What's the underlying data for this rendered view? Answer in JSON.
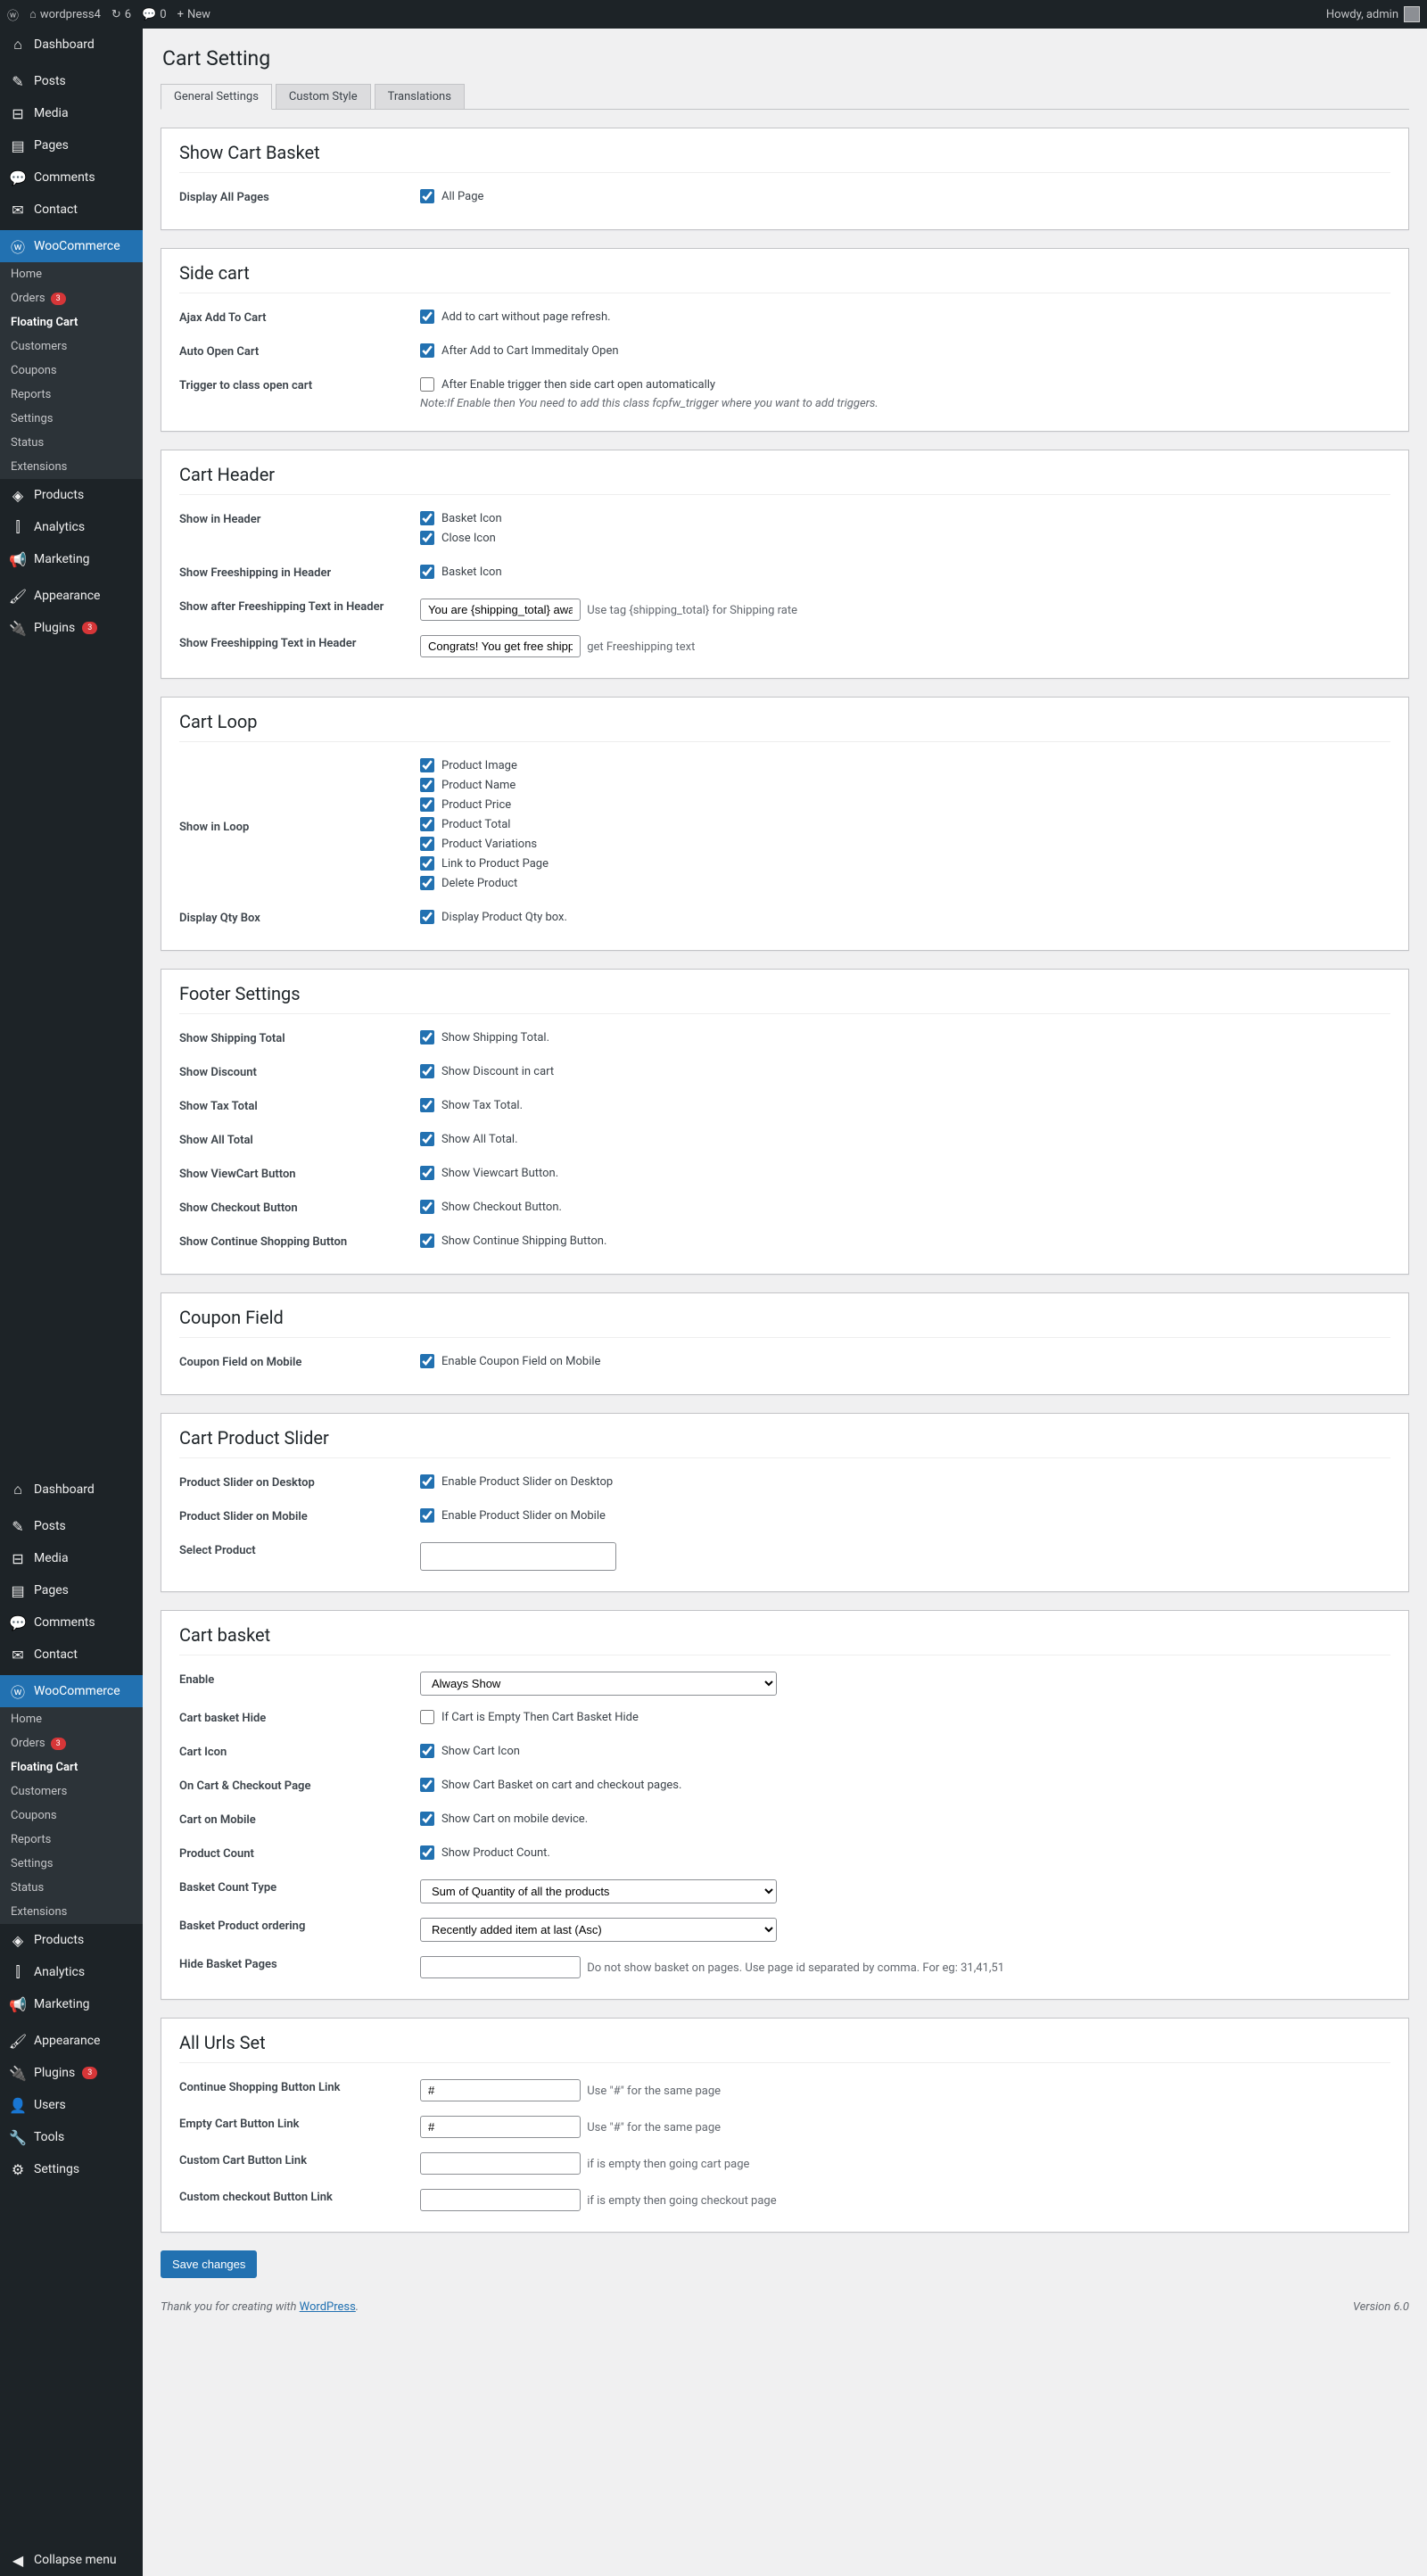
{
  "toolbar": {
    "site_name": "wordpress4",
    "updates": "6",
    "comments": "0",
    "new": "New",
    "howdy": "Howdy, admin"
  },
  "sidebar": {
    "dashboard": "Dashboard",
    "posts": "Posts",
    "media": "Media",
    "pages": "Pages",
    "comments": "Comments",
    "contact": "Contact",
    "woocommerce": "WooCommerce",
    "woo_sub": {
      "home": "Home",
      "orders": "Orders",
      "orders_count": "3",
      "floating_cart": "Floating Cart",
      "customers": "Customers",
      "coupons": "Coupons",
      "reports": "Reports",
      "settings": "Settings",
      "status": "Status",
      "extensions": "Extensions"
    },
    "products": "Products",
    "analytics": "Analytics",
    "marketing": "Marketing",
    "appearance": "Appearance",
    "plugins": "Plugins",
    "plugins_count": "3",
    "users": "Users",
    "tools": "Tools",
    "settings": "Settings",
    "collapse": "Collapse menu"
  },
  "page": {
    "title": "Cart Setting",
    "tabs": {
      "general": "General Settings",
      "custom": "Custom Style",
      "translations": "Translations"
    }
  },
  "sections": {
    "show_cart_basket": {
      "title": "Show Cart Basket",
      "display_all_pages": "Display All Pages",
      "all_page": "All Page"
    },
    "side_cart": {
      "title": "Side cart",
      "ajax_label": "Ajax Add To Cart",
      "ajax_text": "Add to cart without page refresh.",
      "auto_label": "Auto Open Cart",
      "auto_text": "After Add to Cart Immeditaly Open",
      "trigger_label": "Trigger to class open cart",
      "trigger_text": "After Enable trigger then side cart open automatically",
      "trigger_note_pre": "Note:If Enable then You need to add this class",
      "trigger_class": "fcpfw_trigger",
      "trigger_note_post": "where you want to add triggers."
    },
    "cart_header": {
      "title": "Cart Header",
      "show_header": "Show in Header",
      "basket_icon": "Basket Icon",
      "close_icon": "Close Icon",
      "show_freeship": "Show Freeshipping in Header",
      "after_freeship_label": "Show after Freeshipping Text in Header",
      "after_freeship_value": "You are {shipping_total} away",
      "after_freeship_note_pre": "Use tag",
      "after_freeship_tag": "{shipping_total}",
      "after_freeship_note_post": "for Shipping rate",
      "freeship_text_label": "Show Freeshipping Text in Header",
      "freeship_text_value": "Congrats! You get free shipping",
      "freeship_text_note": "get Freeshipping text"
    },
    "cart_loop": {
      "title": "Cart Loop",
      "show_loop": "Show in Loop",
      "items": [
        "Product Image",
        "Product Name",
        "Product Price",
        "Product Total",
        "Product Variations",
        "Link to Product Page",
        "Delete Product"
      ],
      "qty_label": "Display Qty Box",
      "qty_text": "Display Product Qty box."
    },
    "footer": {
      "title": "Footer Settings",
      "rows": [
        {
          "label": "Show Shipping Total",
          "text": "Show Shipping Total."
        },
        {
          "label": "Show Discount",
          "text": "Show Discount in cart"
        },
        {
          "label": "Show Tax Total",
          "text": "Show Tax Total."
        },
        {
          "label": "Show All Total",
          "text": "Show All Total."
        },
        {
          "label": "Show ViewCart Button",
          "text": "Show Viewcart Button."
        },
        {
          "label": "Show Checkout Button",
          "text": "Show Checkout Button."
        },
        {
          "label": "Show Continue Shopping Button",
          "text": "Show Continue Shipping Button."
        }
      ]
    },
    "coupon": {
      "title": "Coupon Field",
      "label": "Coupon Field on Mobile",
      "text": "Enable Coupon Field on Mobile"
    },
    "slider": {
      "title": "Cart Product Slider",
      "desktop_label": "Product Slider on Desktop",
      "desktop_text": "Enable Product Slider on Desktop",
      "mobile_label": "Product Slider on Mobile",
      "mobile_text": "Enable Product Slider on Mobile",
      "select_label": "Select Product"
    },
    "basket": {
      "title": "Cart basket",
      "enable_label": "Enable",
      "enable_option": "Always Show",
      "hide_label": "Cart basket Hide",
      "hide_text": "If Cart is Empty Then Cart Basket Hide",
      "icon_label": "Cart Icon",
      "icon_text": "Show Cart Icon",
      "checkout_label": "On Cart & Checkout Page",
      "checkout_text": "Show Cart Basket on cart and checkout pages.",
      "mobile_label": "Cart on Mobile",
      "mobile_text": "Show Cart on mobile device.",
      "count_label": "Product Count",
      "count_text": "Show Product Count.",
      "count_type_label": "Basket Count Type",
      "count_type_option": "Sum of Quantity of all the products",
      "ordering_label": "Basket Product ordering",
      "ordering_option": "Recently added item at last (Asc)",
      "hide_pages_label": "Hide Basket Pages",
      "hide_pages_note": "Do not show basket on pages. Use page id separated by comma. For eg: 31,41,51"
    },
    "urls": {
      "title": "All Urls Set",
      "continue_label": "Continue Shopping Button Link",
      "hash": "#",
      "same_page": "Use \"#\" for the same page",
      "empty_label": "Empty Cart Button Link",
      "cart_label": "Custom Cart Button Link",
      "cart_note": "if is empty then going cart page",
      "checkout_label": "Custom checkout Button Link",
      "checkout_note": "if is empty then going checkout page"
    }
  },
  "save": "Save changes",
  "footer_thank": "Thank you for creating with ",
  "footer_wp": "WordPress",
  "footer_dot": ".",
  "version": "Version 6.0"
}
